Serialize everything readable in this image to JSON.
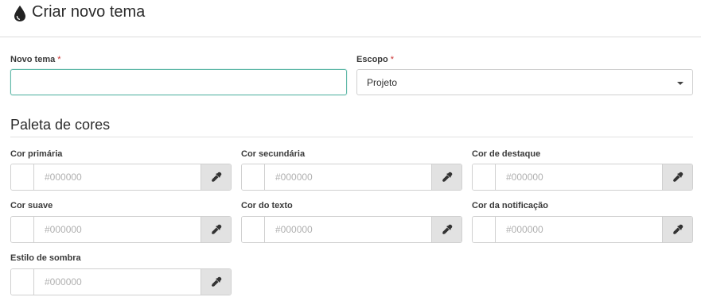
{
  "header": {
    "title": "Criar novo tema",
    "icon": "drop-icon"
  },
  "form": {
    "name": {
      "label": "Novo tema",
      "required_mark": "*",
      "value": ""
    },
    "scope": {
      "label": "Escopo",
      "required_mark": "*",
      "selected": "Projeto"
    }
  },
  "palette": {
    "title": "Paleta de cores",
    "placeholder": "#000000",
    "fields": [
      {
        "label": "Cor primária"
      },
      {
        "label": "Cor secundária"
      },
      {
        "label": "Cor de destaque"
      },
      {
        "label": "Cor suave"
      },
      {
        "label": "Cor do texto"
      },
      {
        "label": "Cor da notificação"
      },
      {
        "label": "Estilo de sombra"
      }
    ]
  },
  "colors": {
    "focus_border": "#5fb8a8",
    "required": "#cc3333",
    "picker_bg": "#e2e2e2"
  }
}
